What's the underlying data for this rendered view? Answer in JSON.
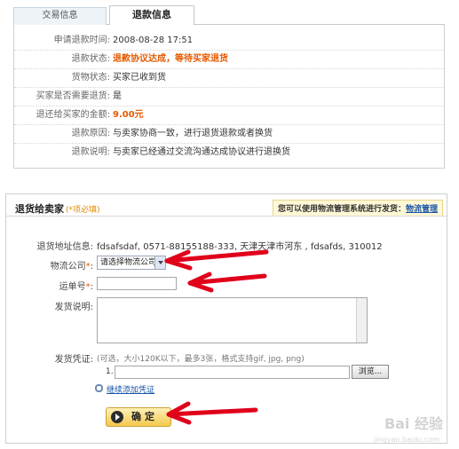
{
  "tabs": [
    {
      "label": "交易信息"
    },
    {
      "label": "退款信息"
    }
  ],
  "refund_info": [
    {
      "label": "申请退款时间:",
      "value": "2008-08-28 17:51",
      "highlight": false
    },
    {
      "label": "退款状态:",
      "value": "退款协议达成，等待买家退货",
      "highlight": true
    },
    {
      "label": "货物状态:",
      "value": "买家已收到货",
      "highlight": false
    },
    {
      "label": "买家是否需要退货:",
      "value": "是",
      "highlight": false
    },
    {
      "label": "退还给买家的金额:",
      "value": "9.00元",
      "highlight": true
    },
    {
      "label": "退款原因:",
      "value": "与卖家协商一致，进行退货退款或者换货",
      "highlight": false
    },
    {
      "label": "退款说明:",
      "value": "与卖家已经通过交流沟通达成协议进行退换货",
      "highlight": false
    }
  ],
  "return_section": {
    "title": "退货给卖家",
    "required_note": "(*项必填)",
    "logistics_tip": "您可以使用物流管理系统进行发货：",
    "logistics_link": "物流管理",
    "address_label": "退货地址信息:",
    "address_value": "fdsafsdaf, 0571-88155188-333, 天津天津市河东 , fdsafds, 310012",
    "company_label": "物流公司",
    "company_select": "请选择物流公司",
    "tracking_label": "运单号",
    "note_label": "发货说明:",
    "proof_label": "发货凭证:",
    "proof_hint": "(可选，大小120K以下，最多3张，格式支持gif, jpg, png)",
    "file_index": "1.",
    "browse_label": "浏览...",
    "add_proof_link": "继续添加凭证",
    "confirm_label": "确定"
  },
  "watermark": {
    "brand": "Bai 经验",
    "url": "jingyan.baidu.com"
  },
  "colors": {
    "highlight": "#e55a00",
    "link": "#1a55a8",
    "annotation_arrow": "#e0001a"
  }
}
